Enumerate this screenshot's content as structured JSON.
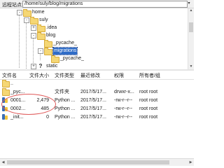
{
  "path_bar": {
    "label": "远程站点:",
    "value": "/home/suly/blog/migrations",
    "dropdown_glyph": "▾"
  },
  "tree": {
    "items": [
      {
        "label": "home",
        "expander": "-"
      },
      {
        "label": "suly",
        "expander": "-"
      },
      {
        "label": ".idea",
        "expander": "+"
      },
      {
        "label": "blog",
        "expander": "-"
      },
      {
        "label": "_pycache_",
        "expander": ""
      },
      {
        "label": "migrations",
        "expander": "-"
      },
      {
        "label": "_pycache_",
        "expander": ""
      },
      {
        "label": "static",
        "expander": "+"
      }
    ]
  },
  "file_list": {
    "columns": [
      "文件名",
      "文件大小",
      "文件类型",
      "最近修改",
      "权限",
      "所有者/组"
    ],
    "rows": [
      {
        "name": "..",
        "size": "",
        "type": "",
        "modified": "",
        "perms": "",
        "owner": "",
        "icon": "folder-icon"
      },
      {
        "name": "_pyc...",
        "size": "",
        "type": "文件夹",
        "modified": "2017/5/17...",
        "perms": "drwxr-x...",
        "owner": "root root",
        "icon": "folder-icon"
      },
      {
        "name": "0001...",
        "size": "2,479",
        "type": "Python ...",
        "modified": "2017/5/17...",
        "perms": "-rw-r--r--",
        "owner": "root root",
        "icon": "python-file-icon"
      },
      {
        "name": "0002...",
        "size": "485",
        "type": "Python ...",
        "modified": "2017/5/17...",
        "perms": "-rw-r--r--",
        "owner": "root root",
        "icon": "python-file-icon"
      },
      {
        "name": "_init...",
        "size": "0",
        "type": "Python ...",
        "modified": "2017/5/17...",
        "perms": "-rw-r--r--",
        "owner": "root root",
        "icon": "python-file-icon"
      }
    ]
  },
  "colors": {
    "selection": "#2f6cc7",
    "annotation": "#e05a5a",
    "folder": "#f5d775"
  }
}
